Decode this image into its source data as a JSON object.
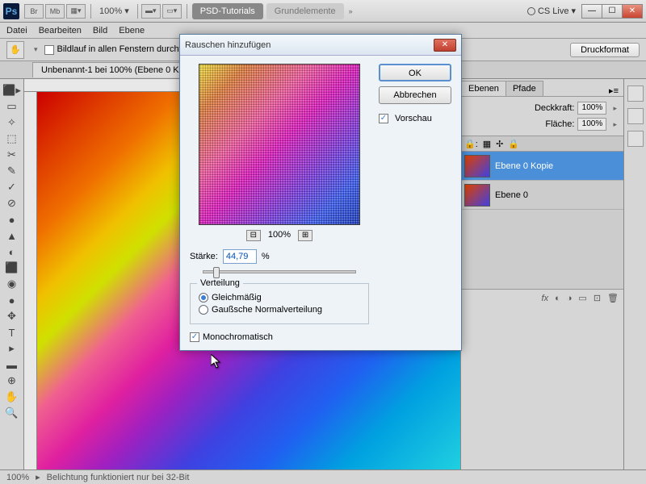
{
  "titlebar": {
    "app_badge": "Ps",
    "small_badges": [
      "Br",
      "Mb"
    ],
    "zoom": "100%",
    "tabs": [
      "PSD-Tutorials",
      "Grundelemente"
    ],
    "cslive": "CS Live"
  },
  "menus": [
    "Datei",
    "Bearbeiten",
    "Bild",
    "Ebene"
  ],
  "optionsbar": {
    "scroll_all": "Bildlauf in allen Fenstern durchf",
    "print_format": "Druckformat"
  },
  "doc_tab": "Unbenannt-1 bei 100% (Ebene 0 K",
  "dialog": {
    "title": "Rauschen hinzufügen",
    "ok": "OK",
    "cancel": "Abbrechen",
    "preview_chk": "Vorschau",
    "zoom": "100%",
    "strength_label": "Stärke:",
    "strength_value": "44,79",
    "strength_unit": "%",
    "distribution_legend": "Verteilung",
    "uniform": "Gleichmäßig",
    "gaussian": "Gaußsche Normalverteilung",
    "mono": "Monochromatisch"
  },
  "panels": {
    "layers_tab": "Ebenen",
    "paths_tab": "Pfade",
    "opacity_label": "Deckkraft:",
    "opacity_value": "100%",
    "fill_label": "Fläche:",
    "fill_value": "100%",
    "lock_label": "",
    "layer0_copy": "Ebene 0 Kopie",
    "layer0": "Ebene 0",
    "footer_icons": [
      "fx",
      "◐",
      "□",
      "◑",
      "▦",
      "⊡",
      "🗑"
    ]
  },
  "statusbar": {
    "zoom": "100%",
    "hint": "Belichtung funktioniert nur bei 32-Bit"
  },
  "tools": [
    "▸",
    "▭",
    "✧",
    "⬚",
    "✂",
    "✎",
    "✓",
    "⊘",
    "●",
    "▲",
    "◐",
    "⬛",
    "T",
    "⬜",
    "◉",
    "✥",
    "⊕",
    "⬜",
    "⬛"
  ]
}
